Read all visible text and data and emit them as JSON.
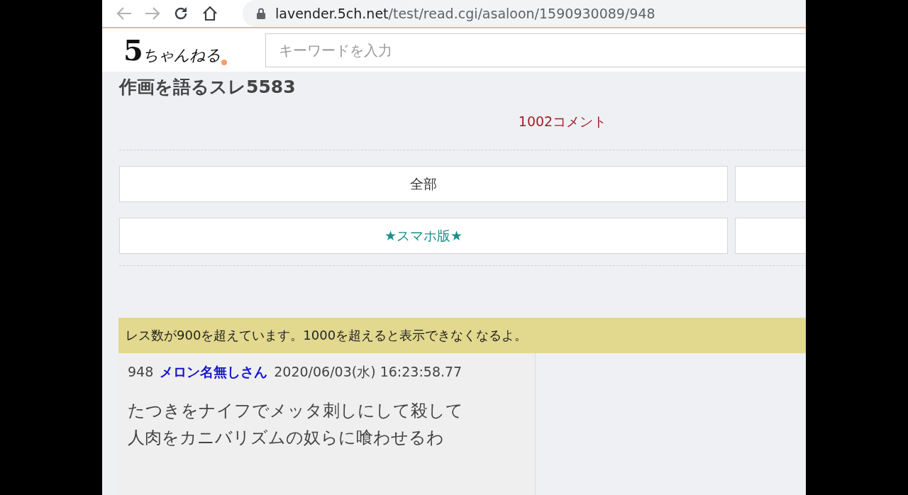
{
  "browser": {
    "url_host": "lavender.5ch.net",
    "url_path": "/test/read.cgi/asaloon/1590930089/948"
  },
  "header": {
    "logo": "5ちゃんねる",
    "search": {
      "placeholder": "キーワードを入力"
    }
  },
  "thread": {
    "title": "作画を語るスレ5583",
    "comment_count": "1002コメント",
    "button_rows": [
      {
        "label": "全部",
        "kind": "plain"
      },
      {
        "label": "★スマホ版★",
        "kind": "accent"
      }
    ],
    "notice": "レス数が900を超えています。1000を超えると表示できなくなるよ。",
    "posts": [
      {
        "number": "948",
        "name": "メロン名無しさん",
        "date": "2020/06/03(水) 16:23:58.77",
        "lines": [
          "たつきをナイフでメッタ刺しにして殺して",
          "人肉をカニバリズムの奴らに喰わせるわ"
        ]
      }
    ]
  }
}
